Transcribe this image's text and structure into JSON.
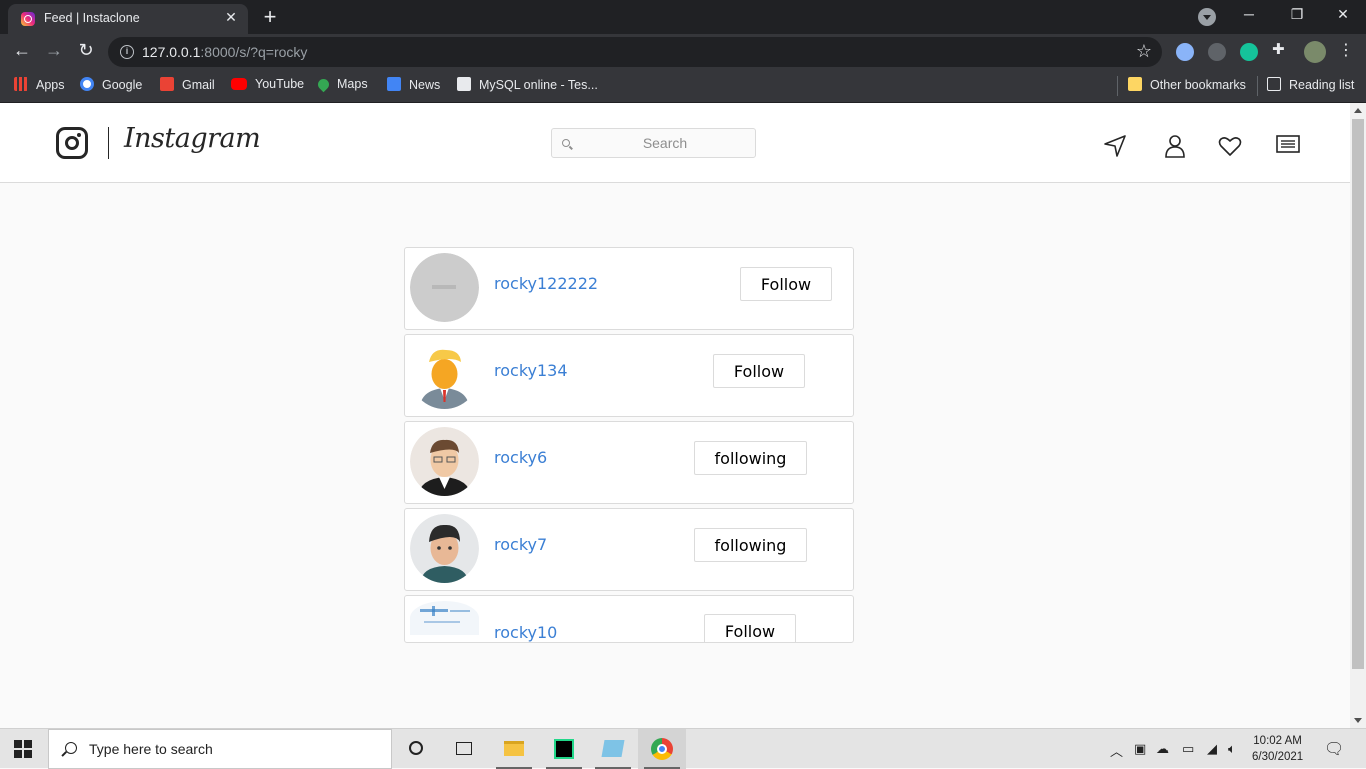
{
  "browser": {
    "tab_title": "Feed | Instaclone",
    "tab_close": "✕",
    "new_tab": "+",
    "url_host": "127.0.0.1",
    "url_path": ":8000/s/?q=rocky",
    "bookmarks": [
      {
        "label": "Apps",
        "icon_color": "#ea4335"
      },
      {
        "label": "Google",
        "icon_color": "#4285f4"
      },
      {
        "label": "Gmail",
        "icon_color": "#ea4335"
      },
      {
        "label": "YouTube",
        "icon_color": "#ff0000"
      },
      {
        "label": "Maps",
        "icon_color": "#34a853"
      },
      {
        "label": "News",
        "icon_color": "#4285f4"
      },
      {
        "label": "MySQL online - Tes...",
        "icon_color": "#e8eaed"
      }
    ],
    "other_bookmarks": "Other bookmarks",
    "reading_list": "Reading list"
  },
  "header": {
    "wordmark": "Instagram",
    "search_placeholder": "Search",
    "icons": [
      "send-icon",
      "profile-icon",
      "heart-icon",
      "feed-icon"
    ]
  },
  "results": [
    {
      "username": "rocky122222",
      "button": "Follow",
      "avatar": "placeholder"
    },
    {
      "username": "rocky134",
      "button": "Follow",
      "avatar": "cartoon-man-blond"
    },
    {
      "username": "rocky6",
      "button": "following",
      "avatar": "cartoon-man-glasses"
    },
    {
      "username": "rocky7",
      "button": "following",
      "avatar": "cartoon-man-dark-hair"
    },
    {
      "username": "rocky10",
      "button": "Follow",
      "avatar": "abstract-blue"
    }
  ],
  "taskbar": {
    "search_text": "Type here to search",
    "time": "10:02 AM",
    "date": "6/30/2021"
  },
  "colors": {
    "link": "#3b7fd4",
    "chrome_dark": "#202124",
    "chrome_mid": "#35363a",
    "page_bg": "#fafafa"
  }
}
